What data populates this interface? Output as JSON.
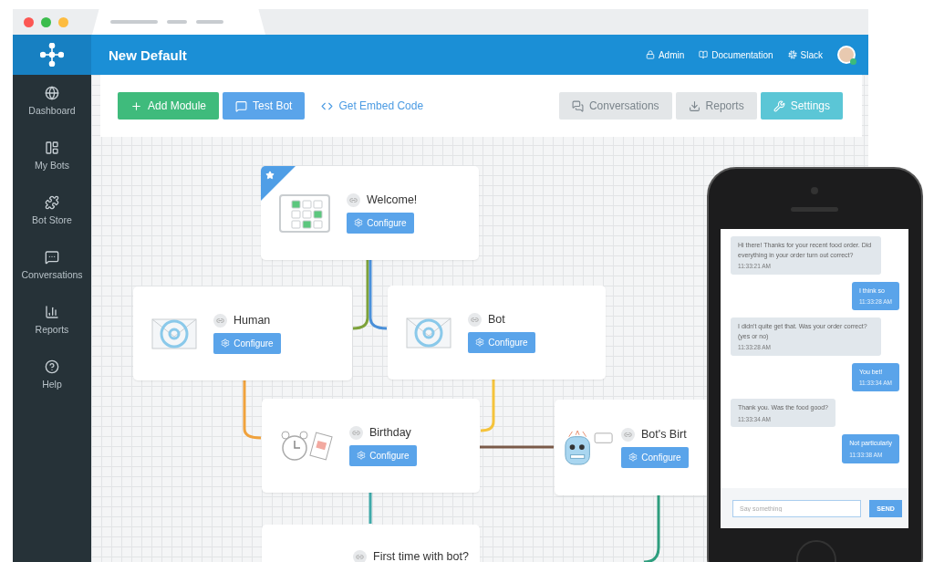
{
  "header": {
    "title": "New Default",
    "links": [
      {
        "label": "Admin"
      },
      {
        "label": "Documentation"
      },
      {
        "label": "Slack"
      }
    ]
  },
  "sidebar": {
    "items": [
      {
        "label": "Dashboard"
      },
      {
        "label": "My Bots"
      },
      {
        "label": "Bot Store"
      },
      {
        "label": "Conversations"
      },
      {
        "label": "Reports"
      },
      {
        "label": "Help"
      }
    ]
  },
  "toolbar": {
    "left": [
      {
        "label": "Add Module",
        "kind": "primary"
      },
      {
        "label": "Test Bot",
        "kind": "info"
      },
      {
        "label": "Get Embed Code",
        "kind": "link"
      }
    ],
    "right": [
      {
        "label": "Conversations",
        "kind": "plain"
      },
      {
        "label": "Reports",
        "kind": "plain"
      },
      {
        "label": "Settings",
        "kind": "accent"
      }
    ]
  },
  "modules": [
    {
      "title": "Welcome!",
      "button": "Configure",
      "kind": "checklist",
      "featured": true
    },
    {
      "title": "Human",
      "button": "Configure",
      "kind": "email",
      "featured": false
    },
    {
      "title": "Bot",
      "button": "Configure",
      "kind": "email",
      "featured": false
    },
    {
      "title": "Birthday",
      "button": "Configure",
      "kind": "alarm",
      "featured": false
    },
    {
      "title": "Bot's Birt",
      "button": "Configure",
      "kind": "robot",
      "featured": false
    },
    {
      "title": "First time with bot?",
      "kind": "plain",
      "featured": false
    }
  ],
  "chat": {
    "messages": [
      {
        "kind": "bot",
        "text": "Hi there! Thanks for your recent food order. Did everything in your order turn out correct?",
        "time": "11:33:21 AM"
      },
      {
        "kind": "user",
        "text": "I think so",
        "time": "11:33:28 AM"
      },
      {
        "kind": "bot",
        "text": "I didn't quite get that. Was your order correct? (yes or no)",
        "time": "11:33:28 AM"
      },
      {
        "kind": "user",
        "text": "You bet!",
        "time": "11:33:34 AM"
      },
      {
        "kind": "bot",
        "text": "Thank you. Was the food good?",
        "time": "11:33:34 AM"
      },
      {
        "kind": "user",
        "text": "Not particularly",
        "time": "11:33:38 AM"
      }
    ],
    "input": {
      "placeholder": "Say something"
    },
    "send": "SEND"
  }
}
